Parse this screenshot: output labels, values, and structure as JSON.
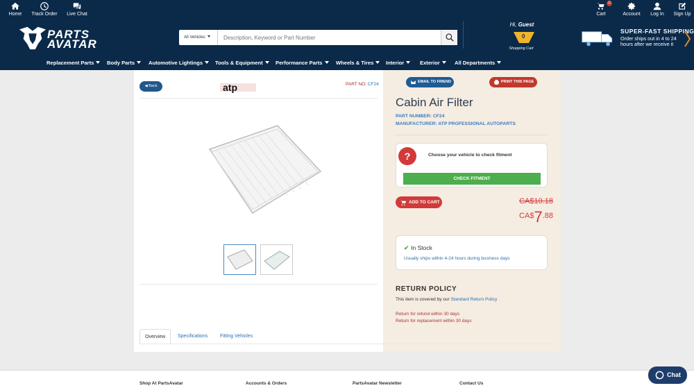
{
  "topbar": {
    "home": "Home",
    "track_order": "Track Order",
    "live_chat": "Live Chat",
    "cart": "Cart",
    "cart_count": "0",
    "account": "Account",
    "login": "Log In",
    "signup": "Sign Up"
  },
  "header": {
    "logo_text": "PARTS AVATAR",
    "vehicle_select": "All Vehicles",
    "search_placeholder": "Description, Keyword or Part Number",
    "greeting": "Hi, ",
    "guest": "Guest",
    "minicart_count": "0",
    "minicart_label": "Shopping Cart",
    "shipping_title": "SUPER-FAST SHIPPING",
    "shipping_text": "Order ships out in 4 to 24 hours after we receive it"
  },
  "nav": [
    "Replacement Parts",
    "Body Parts",
    "Automotive Lightings",
    "Tools & Equipment",
    "Performance Parts",
    "Wheels & Tires",
    "Interior",
    "Exterior",
    "All Departments"
  ],
  "product": {
    "back": "Back",
    "brand_logo": "atp",
    "part_no_label": "PART NO: ",
    "part_no_value": "CF24",
    "title": "Cabin Air Filter",
    "part_number_line": "PART NUMBER: CF24",
    "manufacturer_line": "MANUFACTURER: ATP PROFESSIONAL AUTOPARTS",
    "email_friend": "EMAIL TO FRIEND",
    "print_page": "PRINT THIS PAGE",
    "fit_prompt": "Choose your vehicle to check fitment",
    "check_fitment": "CHECK FITMENT",
    "add_to_cart": "ADD TO CART",
    "price_old": "CA$10.18",
    "price_currency": "CA$",
    "price_whole": "7",
    "price_cents": ".88",
    "stock_status": "In Stock",
    "stock_note": "Usually ships within 4-24 hours during business days"
  },
  "return_policy": {
    "title": "RETURN POLICY",
    "line1_prefix": "This item is covered by our ",
    "line1_link": "Standard Return Policy",
    "line2": "Return for refund within 30 days",
    "line3": "Return for replacement within 30 days"
  },
  "tabs": [
    "Overview",
    "Specifications",
    "Fitting Vehicles"
  ],
  "footer": {
    "col1": "Shop At PartsAvatar",
    "col2": "Accounts & Orders",
    "col3": "PartsAvatar Newsletter",
    "col4": "Contact Us",
    "chat": "Chat"
  },
  "colors": {
    "brand_navy": "#0b2a4a",
    "accent_red": "#d23a3a",
    "success_green": "#4cae4c",
    "link_blue": "#2a6fb0"
  }
}
